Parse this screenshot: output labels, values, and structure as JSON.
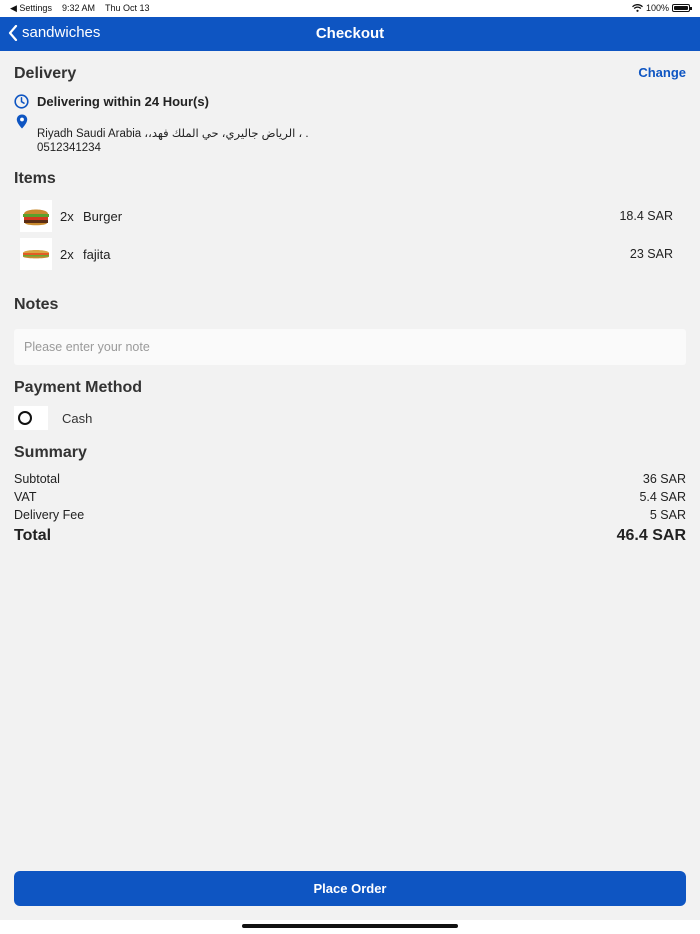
{
  "status_bar": {
    "back_app": "◀ Settings",
    "time": "9:32 AM",
    "date": "Thu Oct 13",
    "battery": "100%",
    "battery_level": 1.0
  },
  "nav": {
    "back_label": "sandwiches",
    "title": "Checkout"
  },
  "delivery": {
    "title": "Delivery",
    "change_label": "Change",
    "eta": "Delivering within 24 Hour(s)",
    "address_line": "Riyadh Saudi Arabia ،،الرياض جاليري، حي الملك فهد ، .",
    "phone": "0512341234"
  },
  "items": {
    "title": "Items",
    "list": [
      {
        "qty": "2x",
        "name": "Burger",
        "price": "18.4 SAR",
        "icon": "burger-image"
      },
      {
        "qty": "2x",
        "name": "fajita",
        "price": "23 SAR",
        "icon": "sandwich-image"
      }
    ]
  },
  "notes": {
    "title": "Notes",
    "placeholder": "Please enter your note",
    "value": ""
  },
  "payment": {
    "title": "Payment Method",
    "option_label": "Cash",
    "selected": false
  },
  "summary": {
    "title": "Summary",
    "subtotal_label": "Subtotal",
    "subtotal_value": "36 SAR",
    "vat_label": "VAT",
    "vat_value": "5.4 SAR",
    "delivery_label": "Delivery Fee",
    "delivery_value": "5 SAR",
    "total_label": "Total",
    "total_value": "46.4 SAR"
  },
  "actions": {
    "place_order": "Place Order"
  },
  "colors": {
    "accent": "#0e55c2",
    "background": "#f2f2f2"
  }
}
